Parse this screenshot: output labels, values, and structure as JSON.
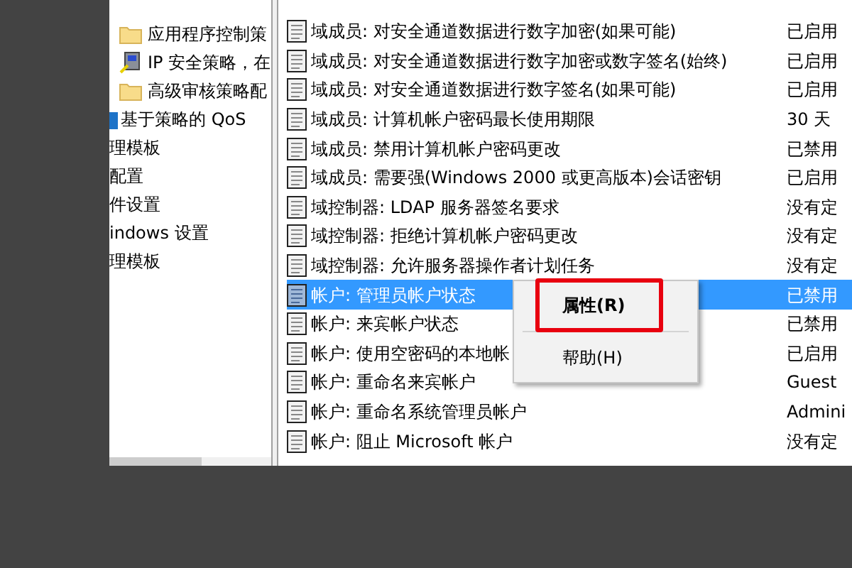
{
  "tree": {
    "sub_items": [
      {
        "label": "应用程序控制策",
        "kind": "folder"
      },
      {
        "label": "IP 安全策略，在",
        "kind": "security"
      },
      {
        "label": "高级审核策略配",
        "kind": "folder"
      }
    ],
    "items": [
      {
        "label": "基于策略的 QoS",
        "kind": "chart"
      },
      {
        "label": "理模板",
        "kind": "plain"
      },
      {
        "label": "配置",
        "kind": "plain"
      },
      {
        "label": "件设置",
        "kind": "plain"
      },
      {
        "label": "indows 设置",
        "kind": "plain"
      },
      {
        "label": "理模板",
        "kind": "plain"
      }
    ]
  },
  "policies": [
    {
      "name": "域成员: 对安全通道数据进行数字加密(如果可能)",
      "setting": "已启用",
      "selected": false
    },
    {
      "name": "域成员: 对安全通道数据进行数字加密或数字签名(始终)",
      "setting": "已启用",
      "selected": false
    },
    {
      "name": "域成员: 对安全通道数据进行数字签名(如果可能)",
      "setting": "已启用",
      "selected": false
    },
    {
      "name": "域成员: 计算机帐户密码最长使用期限",
      "setting": "30 天",
      "selected": false
    },
    {
      "name": "域成员: 禁用计算机帐户密码更改",
      "setting": "已禁用",
      "selected": false
    },
    {
      "name": "域成员: 需要强(Windows 2000 或更高版本)会话密钥",
      "setting": "已启用",
      "selected": false
    },
    {
      "name": "域控制器: LDAP 服务器签名要求",
      "setting": "没有定",
      "selected": false
    },
    {
      "name": "域控制器: 拒绝计算机帐户密码更改",
      "setting": "没有定",
      "selected": false
    },
    {
      "name": "域控制器: 允许服务器操作者计划任务",
      "setting": "没有定",
      "selected": false
    },
    {
      "name": "帐户: 管理员帐户状态",
      "setting": "已禁用",
      "selected": true
    },
    {
      "name": "帐户: 来宾帐户状态",
      "setting": "已禁用",
      "selected": false
    },
    {
      "name": "帐户: 使用空密码的本地帐",
      "setting": "已启用",
      "selected": false
    },
    {
      "name": "帐户: 重命名来宾帐户",
      "setting": "Guest",
      "selected": false
    },
    {
      "name": "帐户: 重命名系统管理员帐户",
      "setting": "Admini",
      "selected": false
    },
    {
      "name": "帐户: 阻止 Microsoft 帐户",
      "setting": "没有定",
      "selected": false
    }
  ],
  "context_menu": [
    {
      "label": "属性(R)",
      "default": true,
      "highlighted": true
    },
    {
      "label": "帮助(H)",
      "default": false,
      "highlighted": false
    }
  ]
}
